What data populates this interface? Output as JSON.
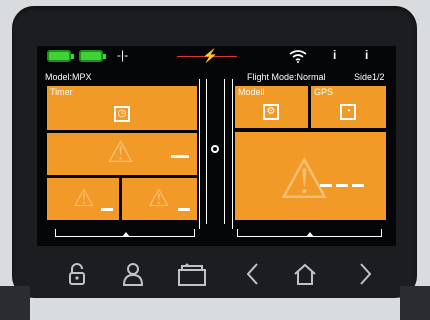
{
  "status": {
    "battery1": "battery-full-icon",
    "battery2": "battery-full-icon",
    "link_symbol": "-|-",
    "wifi_icon": "wifi-icon",
    "temp1": "i",
    "temp2": "i"
  },
  "info": {
    "model": "Model:MPX",
    "flight_mode": "Flight Mode:Normal",
    "side": "Side1/2"
  },
  "tiles": {
    "timer_title": "Timer",
    "modell_title": "Modell",
    "gps_title": "GPS"
  },
  "icons": {
    "timer": "stopwatch-icon",
    "modell": "settings-icon",
    "gps": "gps-dish-icon",
    "warning": "warning-icon"
  },
  "bezel": {
    "lock": "unlock-icon",
    "user": "user-icon",
    "model": "model-icon",
    "back": "chevron-left-icon",
    "home": "home-icon",
    "forward": "chevron-right-icon"
  },
  "colors": {
    "tile": "#f29a28",
    "battery": "#3fd33a",
    "alert": "#ff3b3b"
  }
}
